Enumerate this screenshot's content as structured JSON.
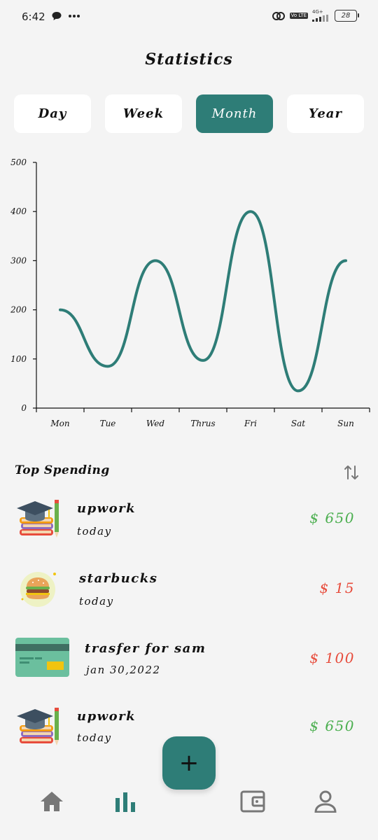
{
  "status_bar": {
    "time": "6:42",
    "battery": "28",
    "network": "4G+",
    "lte": "Vo LTE"
  },
  "header": {
    "title": "Statistics"
  },
  "tabs": [
    {
      "label": "Day",
      "active": false
    },
    {
      "label": "Week",
      "active": false
    },
    {
      "label": "Month",
      "active": true
    },
    {
      "label": "Year",
      "active": false
    }
  ],
  "chart_data": {
    "type": "line",
    "categories": [
      "Mon",
      "Tue",
      "Wed",
      "Thrus",
      "Fri",
      "Sat",
      "Sun"
    ],
    "values": [
      200,
      85,
      300,
      97,
      400,
      35,
      300
    ],
    "ylim": [
      0,
      500
    ],
    "yticks": [
      0,
      100,
      200,
      300,
      400,
      500
    ],
    "color": "#2e7d77",
    "grid": false
  },
  "top_spending": {
    "title": "Top Spending",
    "sort_icon": "sort-arrows-icon",
    "items": [
      {
        "name": "upwork",
        "date": "today",
        "amount": "$ 650",
        "kind": "income",
        "icon": "graduation-books-icon"
      },
      {
        "name": "starbucks",
        "date": "today",
        "amount": "$ 15",
        "kind": "expense",
        "icon": "burger-icon"
      },
      {
        "name": "trasfer for sam",
        "date": "jan 30,2022",
        "amount": "$ 100",
        "kind": "expense",
        "icon": "credit-card-icon"
      },
      {
        "name": "upwork",
        "date": "today",
        "amount": "$ 650",
        "kind": "income",
        "icon": "graduation-books-icon"
      }
    ]
  },
  "colors": {
    "accent": "#2e7d77",
    "income": "#4caf50",
    "expense": "#e74c3c",
    "background": "#f4f4f4"
  },
  "fab": {
    "label": "+"
  },
  "bottom_nav": [
    {
      "icon": "home-icon",
      "active": false
    },
    {
      "icon": "bar-chart-icon",
      "active": true
    },
    {
      "icon": "wallet-icon",
      "active": false
    },
    {
      "icon": "profile-icon",
      "active": false
    }
  ]
}
